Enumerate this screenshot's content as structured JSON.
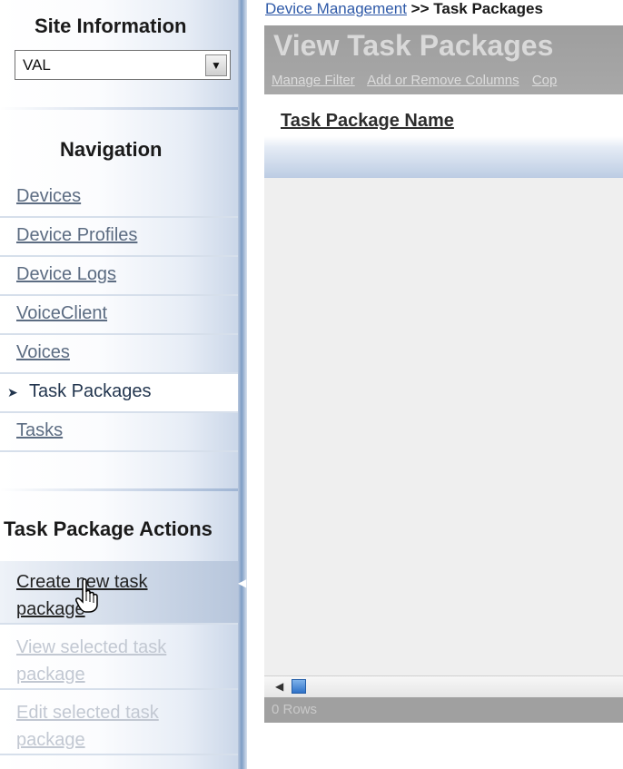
{
  "site_info": {
    "title": "Site Information",
    "selected_site": "VAL"
  },
  "navigation": {
    "title": "Navigation",
    "items": [
      {
        "label": "Devices"
      },
      {
        "label": "Device Profiles"
      },
      {
        "label": "Device Logs"
      },
      {
        "label": "VoiceClient"
      },
      {
        "label": "Voices"
      },
      {
        "label": "Task Packages",
        "active": true
      },
      {
        "label": "Tasks"
      }
    ]
  },
  "actions": {
    "title": "Task Package Actions",
    "items": [
      {
        "label": "Create new task package",
        "enabled": true
      },
      {
        "label": "View selected task package",
        "enabled": false
      },
      {
        "label": "Edit selected task package",
        "enabled": false
      }
    ]
  },
  "breadcrumb": {
    "parent": "Device Management",
    "separator": ">>",
    "current": "Task Packages"
  },
  "main": {
    "page_title": "View Task Packages",
    "toolbar": {
      "manage_filter": "Manage Filter",
      "add_remove_columns": "Add or Remove Columns",
      "copy": "Cop"
    },
    "grid": {
      "columns": [
        "Task Package Name"
      ],
      "row_count": "0 Rows"
    }
  },
  "colors": {
    "header_gray": "#a0a0a0",
    "link_blue": "#2f5aa8",
    "sidebar_edge": "#7d9cc4"
  }
}
